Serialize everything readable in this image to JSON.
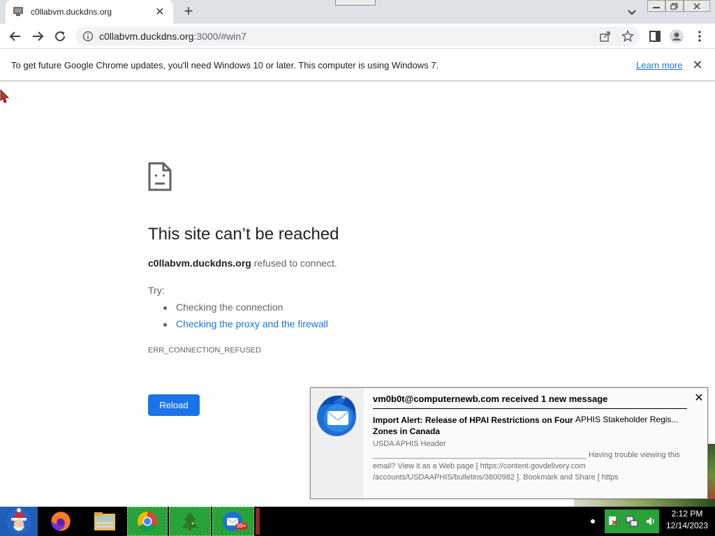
{
  "browser": {
    "tab_title": "c0llabvm.duckdns.org",
    "url_host": "c0llabvm.duckdns.org",
    "url_rest": ":3000/#win7"
  },
  "infobar": {
    "message": "To get future Google Chrome updates, you'll need Windows 10 or later. This computer is using Windows 7.",
    "link": "Learn more"
  },
  "error_page": {
    "title": "This site can’t be reached",
    "host": "c0llabvm.duckdns.org",
    "refused": " refused to connect.",
    "try_label": "Try:",
    "suggestions": [
      "Checking the connection",
      "Checking the proxy and the firewall"
    ],
    "error_code": "ERR_CONNECTION_REFUSED",
    "reload_label": "Reload"
  },
  "notification": {
    "header": "vm0b0t@computernewb.com received 1 new message",
    "subject": "Import Alert: Release of HPAI Restrictions on Four Zones in Canada",
    "sender": "APHIS Stakeholder Regis...",
    "preview_line1": "USDA APHIS Header",
    "preview_line2": "__________________________________________________ Having trouble viewing this email? View it as a Web page [ https://content.govdelivery.com /accounts/USDAAPHIS/bulletins/3800982 ]. Bookmark and Share [ https"
  },
  "taskbar": {
    "time": "2:12 PM",
    "date": "12/14/2023",
    "badge": "99+"
  },
  "colors": {
    "accent": "#1a73e8",
    "tabstrip": "#dee1e6",
    "taskbar_active": "#2aa23a"
  }
}
